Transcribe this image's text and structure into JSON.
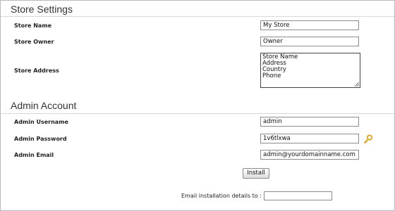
{
  "store_settings": {
    "title": "Store Settings",
    "store_name_label": "Store Name",
    "store_name_value": "My Store",
    "store_owner_label": "Store Owner",
    "store_owner_value": "Owner",
    "store_address_label": "Store Address",
    "store_address_lines": [
      "Store Name",
      "Address",
      "Country",
      "Phone"
    ]
  },
  "admin_account": {
    "title": "Admin Account",
    "username_label": "Admin Username",
    "username_value": "admin",
    "password_label": "Admin Password",
    "password_value": "1v6tlxwa",
    "email_label": "Admin Email",
    "email_value": "admin@yourdomainname.com"
  },
  "actions": {
    "install_label": "Install",
    "email_details_label": "Email installation details to :",
    "email_details_value": ""
  },
  "icons": {
    "password_generator": "key-icon"
  },
  "colors": {
    "divider": "#cfd9df",
    "key_icon": "#d9a520"
  }
}
